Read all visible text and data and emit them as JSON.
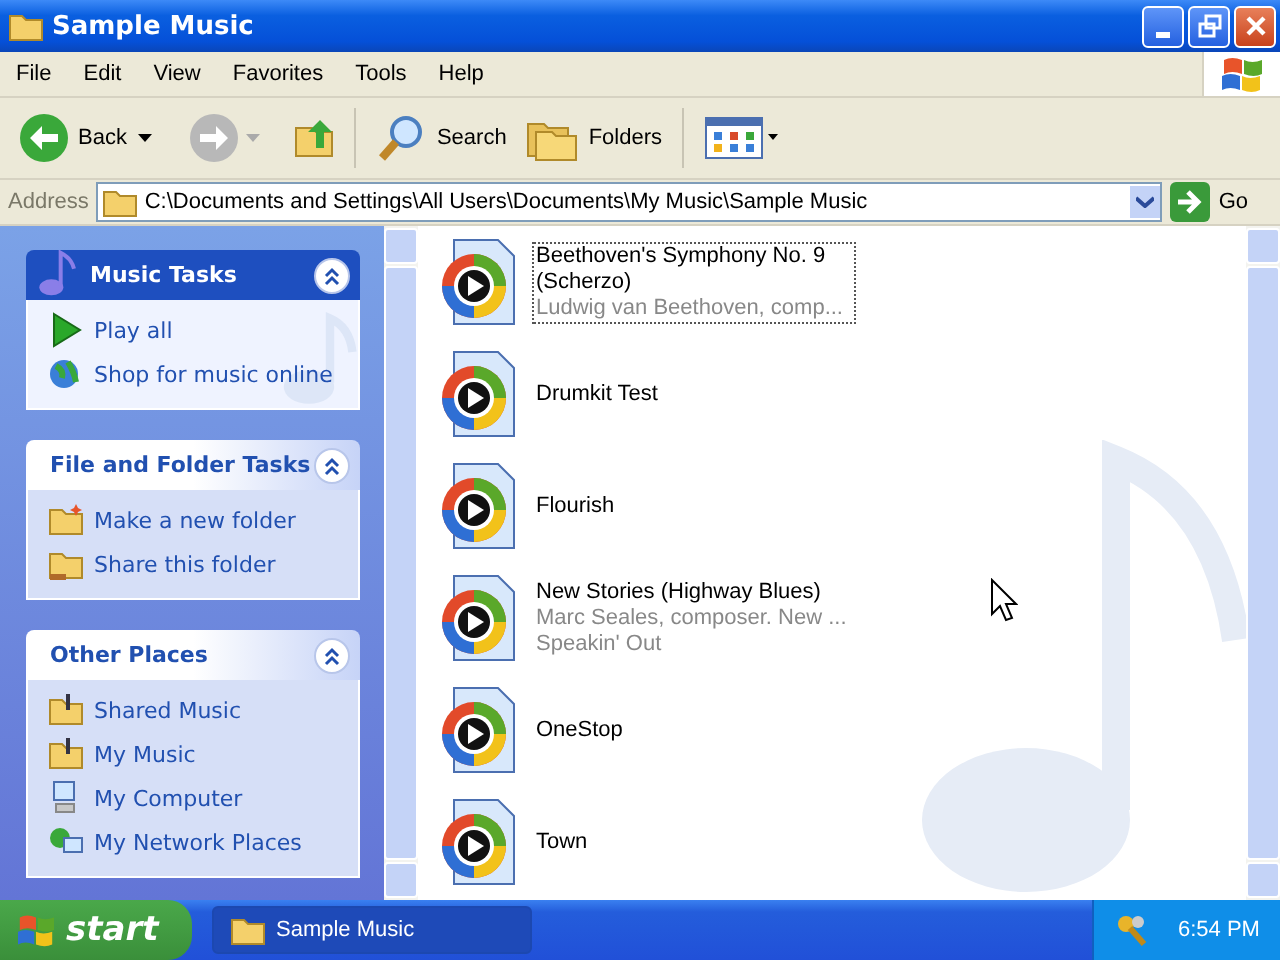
{
  "window": {
    "title": "Sample Music"
  },
  "menu": [
    "File",
    "Edit",
    "View",
    "Favorites",
    "Tools",
    "Help"
  ],
  "toolbar": {
    "back": "Back",
    "search": "Search",
    "folders": "Folders"
  },
  "address": {
    "label": "Address",
    "value": "C:\\Documents and Settings\\All Users\\Documents\\My Music\\Sample Music",
    "go": "Go"
  },
  "panels": [
    {
      "title": "Music Tasks",
      "kind": "special",
      "expanded": true,
      "items": [
        {
          "label": "Play all"
        },
        {
          "label": "Shop for music online"
        }
      ]
    },
    {
      "title": "File and Folder Tasks",
      "kind": "normal",
      "expanded": true,
      "items": [
        {
          "label": "Make a new folder"
        },
        {
          "label": "Share this folder"
        }
      ]
    },
    {
      "title": "Other Places",
      "kind": "normal",
      "expanded": true,
      "items": [
        {
          "label": "Shared Music"
        },
        {
          "label": "My Music"
        },
        {
          "label": "My Computer"
        },
        {
          "label": "My Network Places"
        }
      ]
    }
  ],
  "files": [
    {
      "name": "Beethoven's Symphony No. 9 (Scherzo)",
      "details": [
        "Ludwig van Beethoven, comp..."
      ],
      "selected": true
    },
    {
      "name": "Drumkit Test",
      "selected": false
    },
    {
      "name": "Flourish",
      "selected": false
    },
    {
      "name": "New Stories (Highway Blues)",
      "details": [
        "Marc Seales, composer. New ...",
        "Speakin' Out"
      ],
      "selected": false
    },
    {
      "name": "OneStop",
      "selected": false
    },
    {
      "name": "Town",
      "selected": false
    }
  ],
  "taskbar": {
    "start": "start",
    "tasks": [
      {
        "label": "Sample Music",
        "selected": true
      }
    ],
    "clock": "6:54 PM"
  }
}
